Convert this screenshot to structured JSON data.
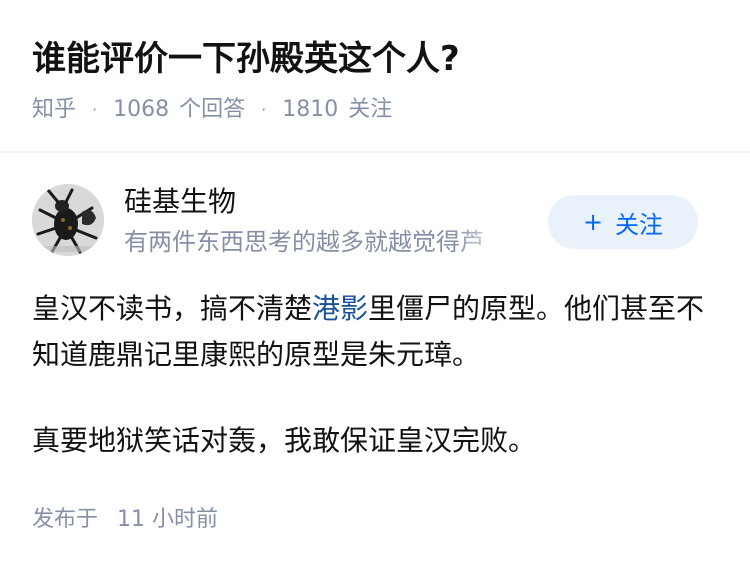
{
  "question": {
    "title": "谁能评价一下孙殿英这个人?",
    "source": "知乎",
    "answer_count": "1068",
    "answer_label": "个回答",
    "follower_count": "1810",
    "follower_label": "关注"
  },
  "author": {
    "name": "硅基生物",
    "bio": "有两件东西思考的越多就越觉得芦",
    "follow_plus": "+",
    "follow_label": "关注"
  },
  "answer": {
    "para1_before": "皇汉不读书，搞不清楚",
    "para1_link": "港影",
    "para1_after": "里僵尸的原型。他们甚至不知道鹿鼎记里康熙的原型是朱元璋。",
    "para2": "真要地狱笑话对轰，我敢保证皇汉完败。"
  },
  "footer": {
    "published_label": "发布于",
    "time": "11 小时前"
  },
  "colors": {
    "meta_gray": "#8590a6",
    "link_blue": "#175199",
    "button_bg": "#e9f1fb",
    "button_text": "#0566ff"
  }
}
